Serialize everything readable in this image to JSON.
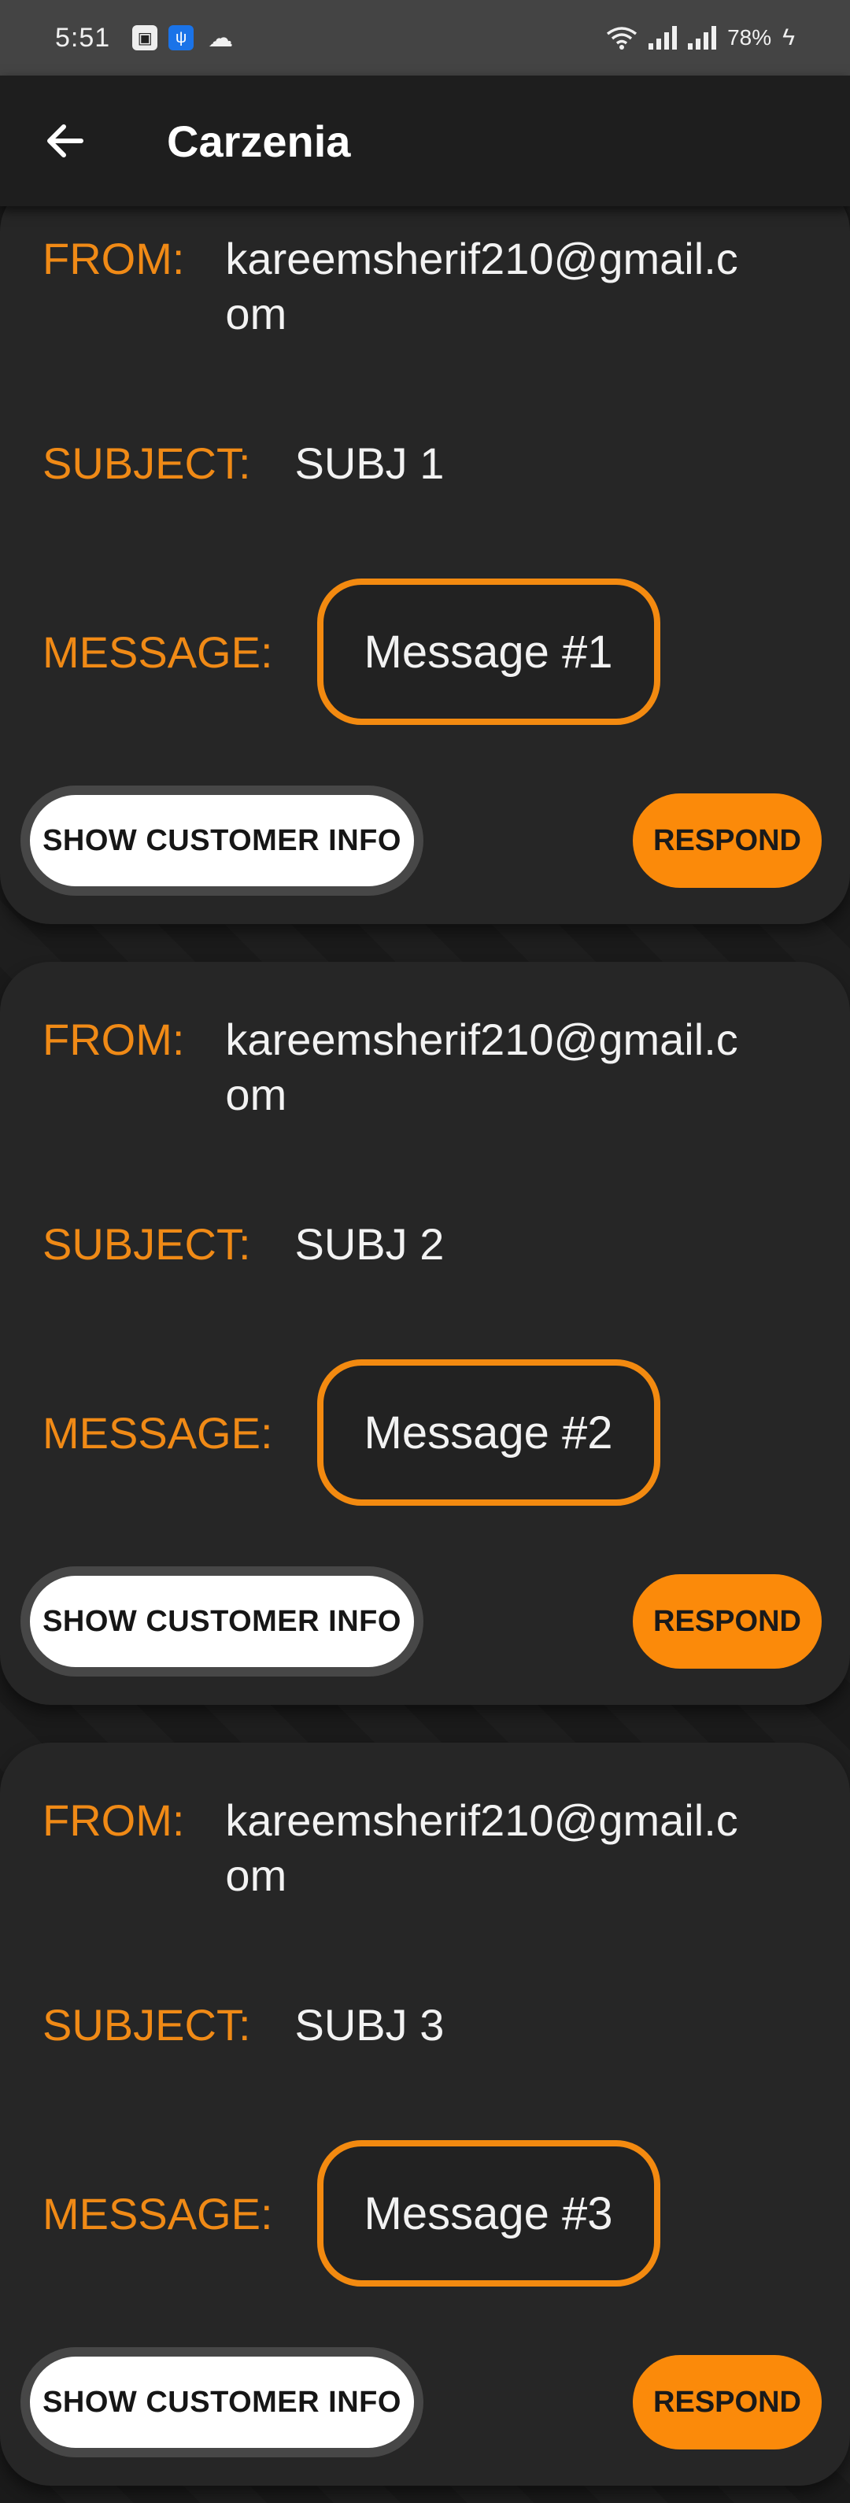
{
  "status_bar": {
    "time": "5:51",
    "battery": "78%",
    "icons": [
      "notification-icon",
      "usb-icon",
      "cloud-icon",
      "wifi-icon",
      "signal-icon",
      "signal-icon",
      "charging-icon"
    ]
  },
  "app_bar": {
    "title": "Carzenia",
    "back_icon": "arrow-left-icon"
  },
  "labels": {
    "from": "FROM:",
    "subject": "SUBJECT:",
    "message": "MESSAGE:",
    "show_customer_info": "SHOW CUSTOMER INFO",
    "respond": "RESPOND"
  },
  "messages": [
    {
      "from": "kareemsherif210@gmail.com",
      "subject": "SUBJ 1",
      "message": "Message #1"
    },
    {
      "from": "kareemsherif210@gmail.com",
      "subject": "SUBJ 2",
      "message": "Message #2"
    },
    {
      "from": "kareemsherif210@gmail.com",
      "subject": "SUBJ 3",
      "message": "Message #3"
    }
  ],
  "colors": {
    "accent": "#F38A10",
    "background": "#1C1C1C",
    "card": "#262626",
    "status_bar": "#444444"
  }
}
